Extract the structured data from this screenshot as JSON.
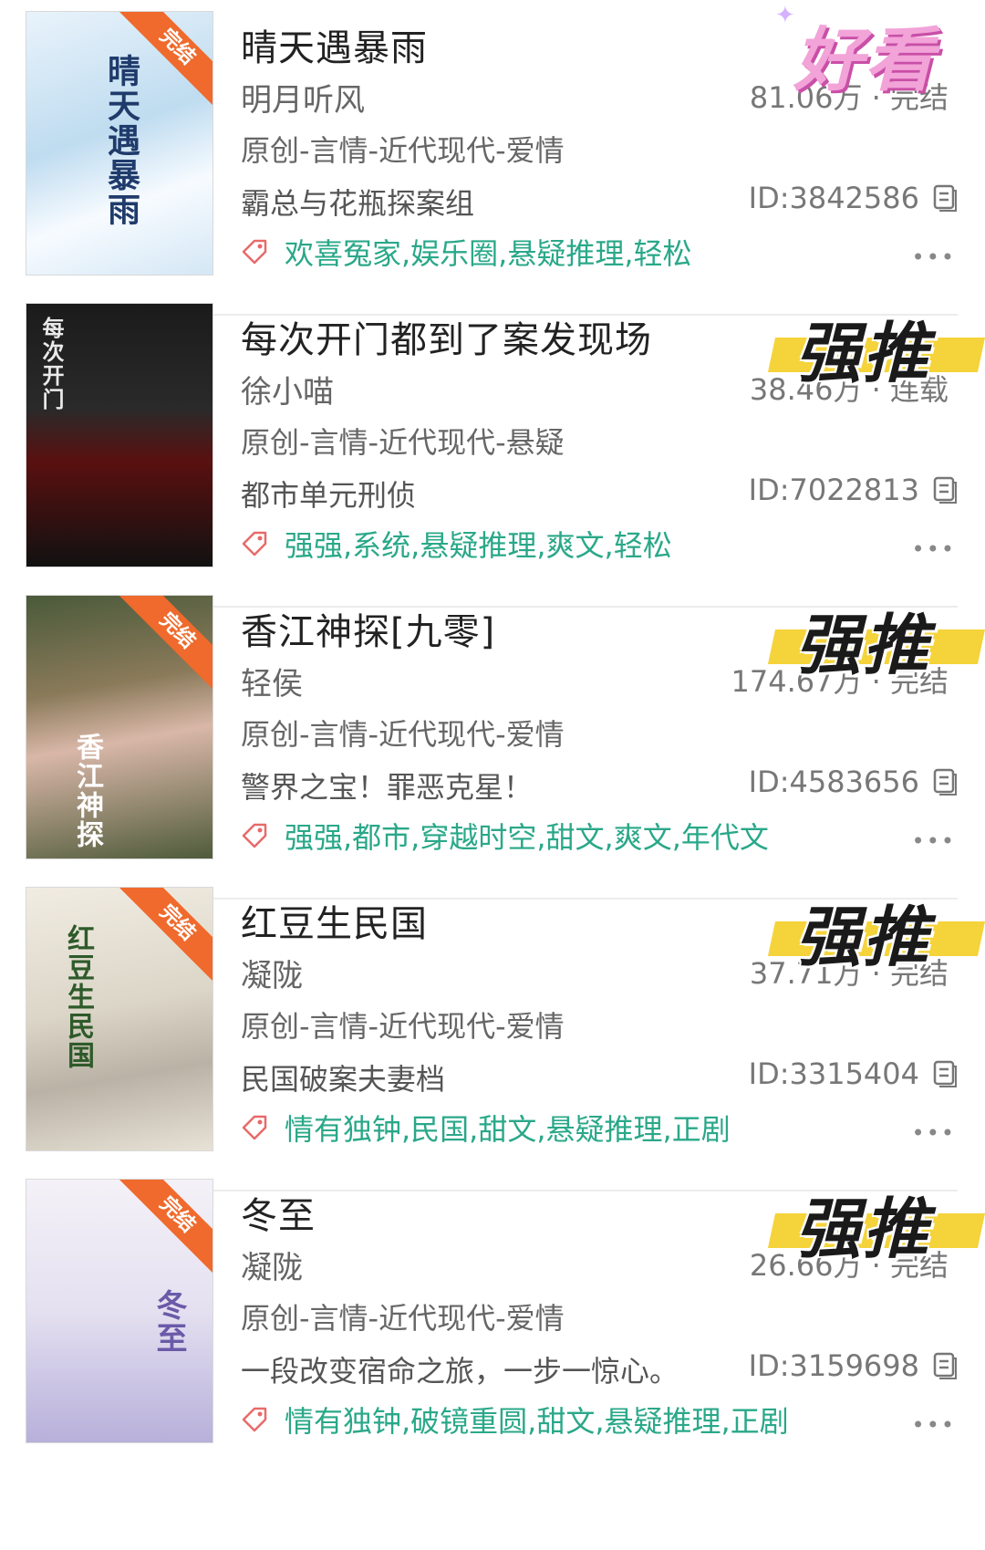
{
  "books": [
    {
      "title": "晴天遇暴雨",
      "author": "明月听风",
      "genre": "原创-言情-近代现代-爱情",
      "description": "霸总与花瓶探案组",
      "stats": "81.06万 · 完结",
      "id": "ID:3842586",
      "tags": "欢喜冤家,娱乐圈,悬疑推理,轻松",
      "badge": "好看",
      "cover_title": "晴天遇暴雨",
      "ribbon": "完结",
      "more": "•••"
    },
    {
      "title": "每次开门都到了案发现场",
      "author": "徐小喵",
      "genre": "原创-言情-近代现代-悬疑",
      "description": "都市单元刑侦",
      "stats": "38.46万 · 连载",
      "id": "ID:7022813",
      "tags": "强强,系统,悬疑推理,爽文,轻松",
      "badge": "强推",
      "cover_title": "每次开门",
      "ribbon": "",
      "more": "•••"
    },
    {
      "title": "香江神探[九零]",
      "author": "轻侯",
      "genre": "原创-言情-近代现代-爱情",
      "description": "警界之宝！罪恶克星！",
      "stats": "174.67万 · 完结",
      "id": "ID:4583656",
      "tags": "强强,都市,穿越时空,甜文,爽文,年代文",
      "badge": "强推",
      "cover_title": "香江神探",
      "ribbon": "完结",
      "more": "•••"
    },
    {
      "title": "红豆生民国",
      "author": "凝陇",
      "genre": "原创-言情-近代现代-爱情",
      "description": "民国破案夫妻档",
      "stats": "37.71万 · 完结",
      "id": "ID:3315404",
      "tags": "情有独钟,民国,甜文,悬疑推理,正剧",
      "badge": "强推",
      "cover_title": "红豆生民国",
      "ribbon": "完结",
      "more": "•••"
    },
    {
      "title": "冬至",
      "author": "凝陇",
      "genre": "原创-言情-近代现代-爱情",
      "description": "一段改变宿命之旅，一步一惊心。",
      "stats": "26.66万 · 完结",
      "id": "ID:3159698",
      "tags": "情有独钟,破镜重圆,甜文,悬疑推理,正剧",
      "badge": "强推",
      "cover_title": "冬至",
      "ribbon": "完结",
      "more": "•••"
    }
  ],
  "colors": {
    "tag": "#2aa889",
    "ribbon": "#ef6a2c",
    "highlight": "#f5d33a"
  }
}
